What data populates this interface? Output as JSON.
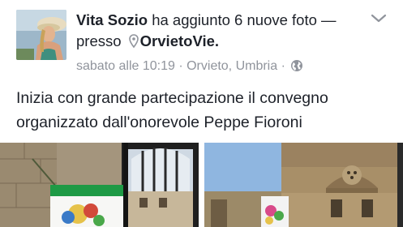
{
  "post": {
    "author": "Vita Sozio",
    "action": "ha aggiunto 6 nuove foto",
    "separator": "— presso",
    "place": "OrvietoVie.",
    "timestamp": "sabato alle 10:19",
    "dot1": "·",
    "location": "Orvieto, Umbria",
    "dot2": "·",
    "privacy_icon": "globe-icon",
    "menu_icon": "chevron-down-icon",
    "place_icon": "map-pin-icon",
    "message_line1": "Inizia con grande partecipazione il convegno",
    "message_line2": "organizzato dall'onorevole Peppe Fioroni"
  },
  "colors": {
    "text": "#1d2129",
    "meta": "#90949c",
    "background": "#ffffff"
  }
}
